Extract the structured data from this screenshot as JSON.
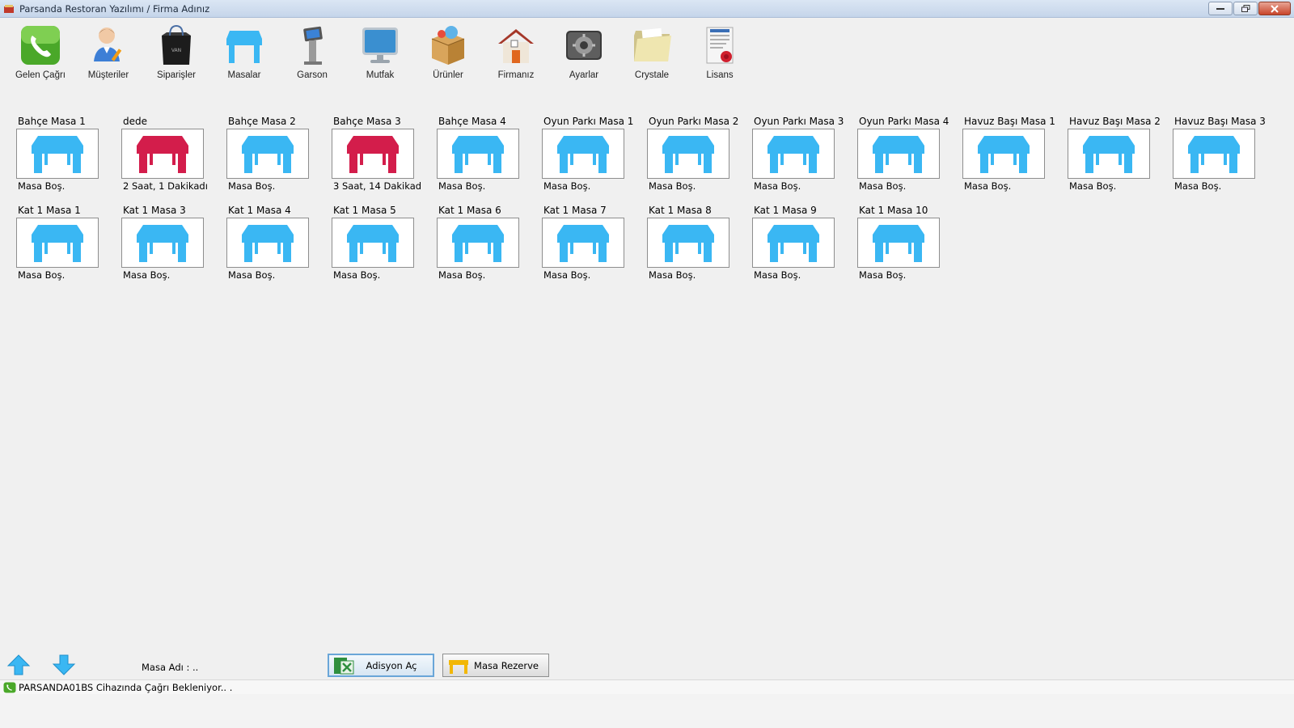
{
  "window": {
    "title": "Parsanda Restoran Yazılımı / Firma Adınız"
  },
  "toolbar": {
    "items": [
      {
        "label": "Gelen Çağrı",
        "icon": "phone-icon"
      },
      {
        "label": "Müşteriler",
        "icon": "customer-icon"
      },
      {
        "label": "Siparişler",
        "icon": "shopping-bag-icon"
      },
      {
        "label": "Masalar",
        "icon": "table-icon"
      },
      {
        "label": "Garson",
        "icon": "kiosk-icon"
      },
      {
        "label": "Mutfak",
        "icon": "monitor-icon"
      },
      {
        "label": "Ürünler",
        "icon": "box-icon"
      },
      {
        "label": "Firmanız",
        "icon": "house-icon"
      },
      {
        "label": "Ayarlar",
        "icon": "settings-icon"
      },
      {
        "label": "Crystale",
        "icon": "folder-icon"
      },
      {
        "label": "Lisans",
        "icon": "certificate-icon"
      }
    ]
  },
  "tables": [
    {
      "name": "Bahçe Masa 1",
      "status": "Masa Boş.",
      "occupied": false
    },
    {
      "name": "dede",
      "status": "2 Saat, 1 Dakikadı",
      "occupied": true
    },
    {
      "name": "Bahçe Masa 2",
      "status": "Masa Boş.",
      "occupied": false
    },
    {
      "name": "Bahçe Masa 3",
      "status": "3 Saat, 14 Dakikad",
      "occupied": true
    },
    {
      "name": "Bahçe Masa 4",
      "status": "Masa Boş.",
      "occupied": false
    },
    {
      "name": "Oyun Parkı Masa 1",
      "status": "Masa Boş.",
      "occupied": false
    },
    {
      "name": "Oyun Parkı Masa 2",
      "status": "Masa Boş.",
      "occupied": false
    },
    {
      "name": "Oyun Parkı Masa 3",
      "status": "Masa Boş.",
      "occupied": false
    },
    {
      "name": "Oyun Parkı Masa 4",
      "status": "Masa Boş.",
      "occupied": false
    },
    {
      "name": "Havuz Başı Masa 1",
      "status": "Masa Boş.",
      "occupied": false
    },
    {
      "name": "Havuz Başı Masa 2",
      "status": "Masa Boş.",
      "occupied": false
    },
    {
      "name": "Havuz Başı Masa 3",
      "status": "Masa Boş.",
      "occupied": false
    },
    {
      "name": "Kat 1 Masa 1",
      "status": "Masa Boş.",
      "occupied": false
    },
    {
      "name": "Kat 1 Masa 3",
      "status": "Masa Boş.",
      "occupied": false
    },
    {
      "name": "Kat 1 Masa 4",
      "status": "Masa Boş.",
      "occupied": false
    },
    {
      "name": "Kat 1 Masa 5",
      "status": "Masa Boş.",
      "occupied": false
    },
    {
      "name": "Kat 1 Masa 6",
      "status": "Masa Boş.",
      "occupied": false
    },
    {
      "name": "Kat 1 Masa 7",
      "status": "Masa Boş.",
      "occupied": false
    },
    {
      "name": "Kat 1 Masa 8",
      "status": "Masa Boş.",
      "occupied": false
    },
    {
      "name": "Kat 1 Masa 9",
      "status": "Masa Boş.",
      "occupied": false
    },
    {
      "name": "Kat 1 Masa 10",
      "status": "Masa Boş.",
      "occupied": false
    }
  ],
  "colors": {
    "empty_table": "#3ab7f3",
    "occupied_table": "#d31d4b"
  },
  "bottom": {
    "masa_adi_label": "Masa Adı : ..",
    "adisyon_button": "Adisyon Aç",
    "rezerve_button": "Masa Rezerve"
  },
  "status": {
    "text": "PARSANDA01BS Cihazında Çağrı Bekleniyor.. ."
  }
}
